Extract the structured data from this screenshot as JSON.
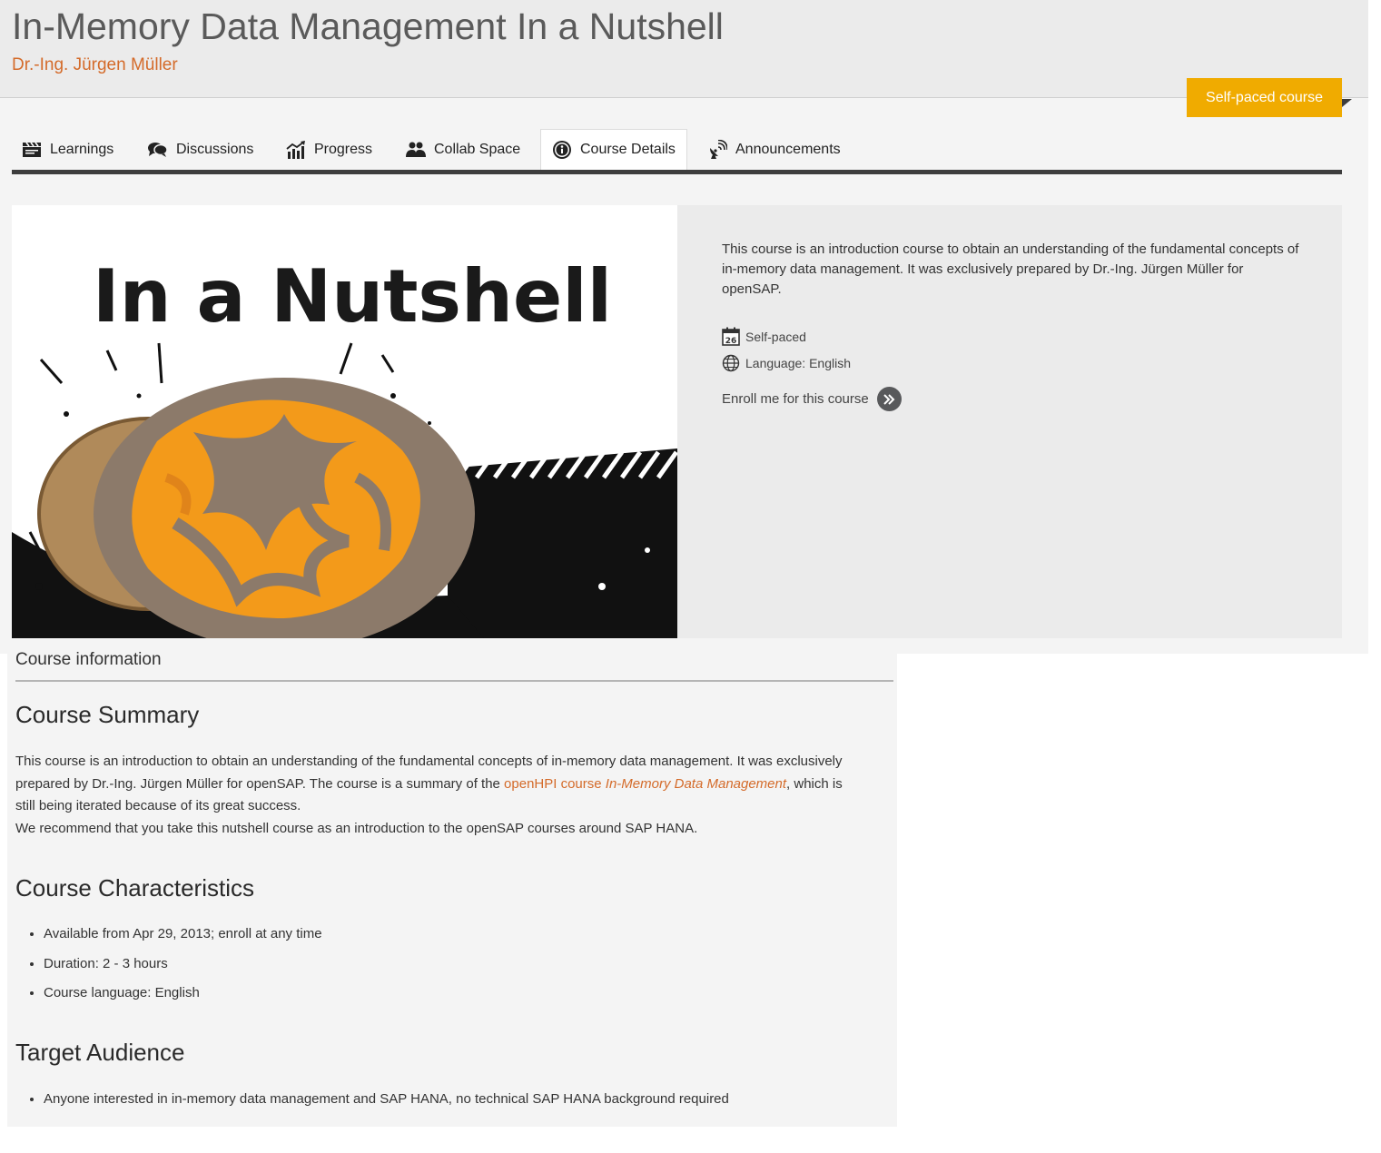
{
  "header": {
    "title": "In-Memory Data Management In a Nutshell",
    "author": "Dr.-Ing. Jürgen Müller",
    "badge": "Self-paced course"
  },
  "tabs": [
    {
      "label": "Learnings",
      "icon": "clapperboard-icon"
    },
    {
      "label": "Discussions",
      "icon": "chat-bubbles-icon"
    },
    {
      "label": "Progress",
      "icon": "chart-icon"
    },
    {
      "label": "Collab Space",
      "icon": "people-icon"
    },
    {
      "label": "Course Details",
      "icon": "info-icon",
      "active": true
    },
    {
      "label": "Announcements",
      "icon": "broadcast-icon"
    }
  ],
  "teaser": {
    "image_title": "In a Nutshell",
    "description": "This course is an introduction course to obtain an understanding of the fundamental concepts of in-memory data management. It was exclusively prepared by Dr.-Ing. Jürgen Müller for openSAP.",
    "calendar_day": "26",
    "pacing": "Self-paced",
    "language": "Language: English",
    "enroll_label": "Enroll me for this course"
  },
  "info": {
    "heading": "Course information",
    "summary_title": "Course Summary",
    "summary_p1": "This course is an introduction to obtain an understanding of the fundamental concepts of in-memory data management. It was exclusively prepared by Dr.-Ing. Jürgen Müller for openSAP. The course is a summary of the ",
    "summary_link_text": "openHPI course ",
    "summary_link_em": "In-Memory Data Management",
    "summary_p1_end": ", which is still being iterated because of its great success.",
    "summary_p2": "We recommend that you take this nutshell course as an introduction to the openSAP courses around SAP HANA.",
    "characteristics_title": "Course Characteristics",
    "characteristics": [
      "Available from Apr 29, 2013; enroll at any time",
      "Duration: 2 - 3 hours",
      "Course language: English"
    ],
    "audience_title": "Target Audience",
    "audience": [
      "Anyone interested in in-memory data management and SAP HANA, no technical SAP HANA background required"
    ]
  },
  "colors": {
    "accent": "#d46b2a",
    "badge": "#f0ab00",
    "tab_line": "#3d3d3d"
  }
}
